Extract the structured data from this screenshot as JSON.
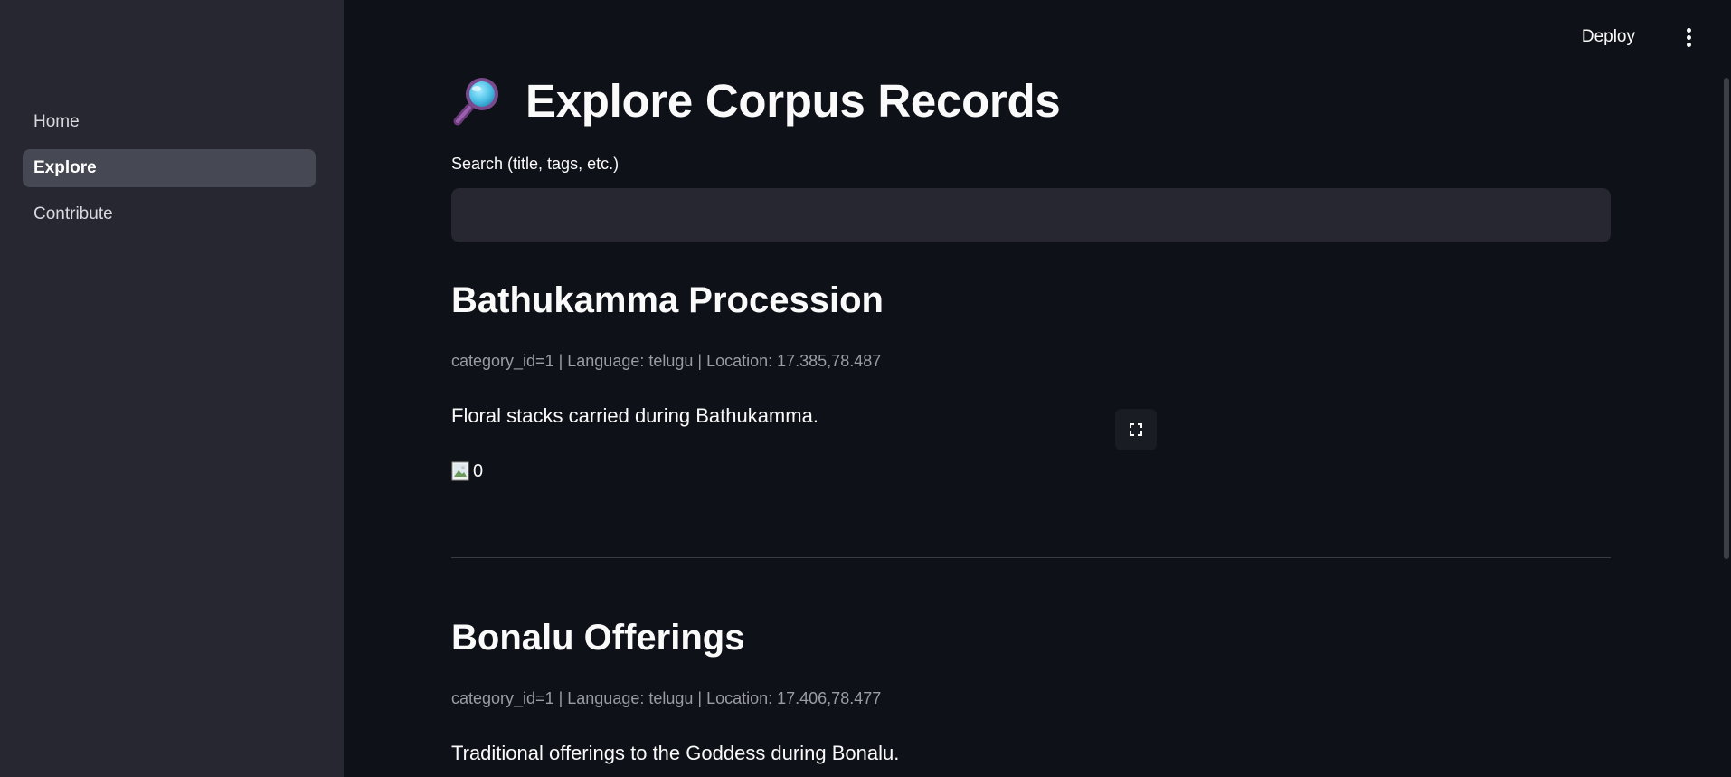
{
  "header": {
    "deploy_label": "Deploy"
  },
  "sidebar": {
    "items": [
      {
        "label": "Home"
      },
      {
        "label": "Explore"
      },
      {
        "label": "Contribute"
      }
    ],
    "active_index": 1
  },
  "main": {
    "title": "Explore Corpus Records",
    "title_icon": "magnifying-glass-icon",
    "search": {
      "label": "Search (title, tags, etc.)",
      "value": "",
      "placeholder": ""
    },
    "records": [
      {
        "title": "Bathukamma Procession",
        "meta": "category_id=1 | Language: telugu | Location: 17.385,78.487",
        "description": "Floral stacks carried during Bathukamma.",
        "image_alt": "0"
      },
      {
        "title": "Bonalu Offerings",
        "meta": "category_id=1 | Language: telugu | Location: 17.406,78.477",
        "description": "Traditional offerings to the Goddess during Bonalu."
      }
    ]
  },
  "colors": {
    "background": "#0e1117",
    "sidebar": "#262730",
    "active_nav": "#464853",
    "input": "#262730",
    "muted_text": "#9b9ca3"
  }
}
